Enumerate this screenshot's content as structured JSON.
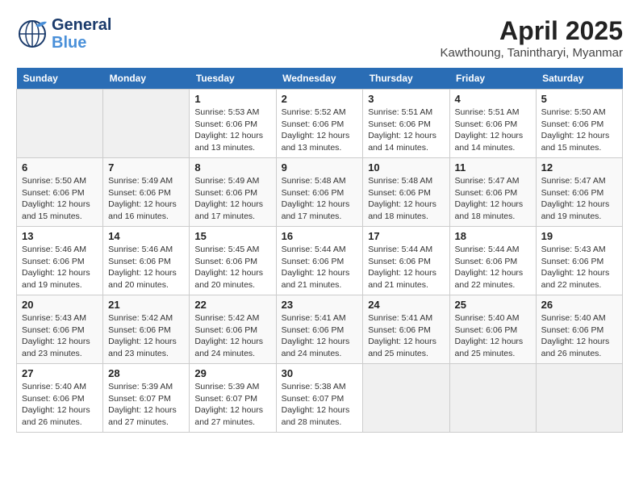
{
  "logo": {
    "line1": "General",
    "line2": "Blue"
  },
  "title": {
    "month_year": "April 2025",
    "location": "Kawthoung, Tanintharyi, Myanmar"
  },
  "days_of_week": [
    "Sunday",
    "Monday",
    "Tuesday",
    "Wednesday",
    "Thursday",
    "Friday",
    "Saturday"
  ],
  "weeks": [
    [
      {
        "day": "",
        "info": ""
      },
      {
        "day": "",
        "info": ""
      },
      {
        "day": "1",
        "info": "Sunrise: 5:53 AM\nSunset: 6:06 PM\nDaylight: 12 hours and 13 minutes."
      },
      {
        "day": "2",
        "info": "Sunrise: 5:52 AM\nSunset: 6:06 PM\nDaylight: 12 hours and 13 minutes."
      },
      {
        "day": "3",
        "info": "Sunrise: 5:51 AM\nSunset: 6:06 PM\nDaylight: 12 hours and 14 minutes."
      },
      {
        "day": "4",
        "info": "Sunrise: 5:51 AM\nSunset: 6:06 PM\nDaylight: 12 hours and 14 minutes."
      },
      {
        "day": "5",
        "info": "Sunrise: 5:50 AM\nSunset: 6:06 PM\nDaylight: 12 hours and 15 minutes."
      }
    ],
    [
      {
        "day": "6",
        "info": "Sunrise: 5:50 AM\nSunset: 6:06 PM\nDaylight: 12 hours and 15 minutes."
      },
      {
        "day": "7",
        "info": "Sunrise: 5:49 AM\nSunset: 6:06 PM\nDaylight: 12 hours and 16 minutes."
      },
      {
        "day": "8",
        "info": "Sunrise: 5:49 AM\nSunset: 6:06 PM\nDaylight: 12 hours and 17 minutes."
      },
      {
        "day": "9",
        "info": "Sunrise: 5:48 AM\nSunset: 6:06 PM\nDaylight: 12 hours and 17 minutes."
      },
      {
        "day": "10",
        "info": "Sunrise: 5:48 AM\nSunset: 6:06 PM\nDaylight: 12 hours and 18 minutes."
      },
      {
        "day": "11",
        "info": "Sunrise: 5:47 AM\nSunset: 6:06 PM\nDaylight: 12 hours and 18 minutes."
      },
      {
        "day": "12",
        "info": "Sunrise: 5:47 AM\nSunset: 6:06 PM\nDaylight: 12 hours and 19 minutes."
      }
    ],
    [
      {
        "day": "13",
        "info": "Sunrise: 5:46 AM\nSunset: 6:06 PM\nDaylight: 12 hours and 19 minutes."
      },
      {
        "day": "14",
        "info": "Sunrise: 5:46 AM\nSunset: 6:06 PM\nDaylight: 12 hours and 20 minutes."
      },
      {
        "day": "15",
        "info": "Sunrise: 5:45 AM\nSunset: 6:06 PM\nDaylight: 12 hours and 20 minutes."
      },
      {
        "day": "16",
        "info": "Sunrise: 5:44 AM\nSunset: 6:06 PM\nDaylight: 12 hours and 21 minutes."
      },
      {
        "day": "17",
        "info": "Sunrise: 5:44 AM\nSunset: 6:06 PM\nDaylight: 12 hours and 21 minutes."
      },
      {
        "day": "18",
        "info": "Sunrise: 5:44 AM\nSunset: 6:06 PM\nDaylight: 12 hours and 22 minutes."
      },
      {
        "day": "19",
        "info": "Sunrise: 5:43 AM\nSunset: 6:06 PM\nDaylight: 12 hours and 22 minutes."
      }
    ],
    [
      {
        "day": "20",
        "info": "Sunrise: 5:43 AM\nSunset: 6:06 PM\nDaylight: 12 hours and 23 minutes."
      },
      {
        "day": "21",
        "info": "Sunrise: 5:42 AM\nSunset: 6:06 PM\nDaylight: 12 hours and 23 minutes."
      },
      {
        "day": "22",
        "info": "Sunrise: 5:42 AM\nSunset: 6:06 PM\nDaylight: 12 hours and 24 minutes."
      },
      {
        "day": "23",
        "info": "Sunrise: 5:41 AM\nSunset: 6:06 PM\nDaylight: 12 hours and 24 minutes."
      },
      {
        "day": "24",
        "info": "Sunrise: 5:41 AM\nSunset: 6:06 PM\nDaylight: 12 hours and 25 minutes."
      },
      {
        "day": "25",
        "info": "Sunrise: 5:40 AM\nSunset: 6:06 PM\nDaylight: 12 hours and 25 minutes."
      },
      {
        "day": "26",
        "info": "Sunrise: 5:40 AM\nSunset: 6:06 PM\nDaylight: 12 hours and 26 minutes."
      }
    ],
    [
      {
        "day": "27",
        "info": "Sunrise: 5:40 AM\nSunset: 6:06 PM\nDaylight: 12 hours and 26 minutes."
      },
      {
        "day": "28",
        "info": "Sunrise: 5:39 AM\nSunset: 6:07 PM\nDaylight: 12 hours and 27 minutes."
      },
      {
        "day": "29",
        "info": "Sunrise: 5:39 AM\nSunset: 6:07 PM\nDaylight: 12 hours and 27 minutes."
      },
      {
        "day": "30",
        "info": "Sunrise: 5:38 AM\nSunset: 6:07 PM\nDaylight: 12 hours and 28 minutes."
      },
      {
        "day": "",
        "info": ""
      },
      {
        "day": "",
        "info": ""
      },
      {
        "day": "",
        "info": ""
      }
    ]
  ]
}
